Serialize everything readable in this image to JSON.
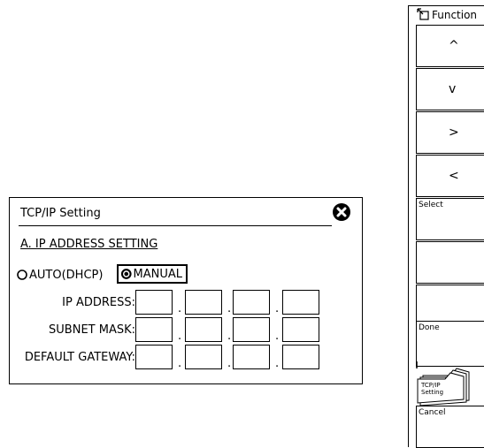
{
  "dialog": {
    "title": "TCP/IP Setting",
    "section": "A. IP ADDRESS SETTING",
    "radio_auto": "AUTO(DHCP)",
    "radio_manual": "MANUAL",
    "selected_mode": "MANUAL",
    "rows": [
      {
        "label": "IP ADDRESS:",
        "octets": [
          "",
          "",
          "",
          ""
        ]
      },
      {
        "label": "SUBNET MASK:",
        "octets": [
          "",
          "",
          "",
          ""
        ]
      },
      {
        "label": "DEFAULT GATEWAY:",
        "octets": [
          "",
          "",
          "",
          ""
        ]
      }
    ],
    "separator": "."
  },
  "panel": {
    "title": "Function",
    "icon": "function-corner-icon",
    "keys": [
      {
        "label": "",
        "symbol": "^"
      },
      {
        "label": "",
        "symbol": "v"
      },
      {
        "label": "",
        "symbol": ">"
      },
      {
        "label": "",
        "symbol": "<"
      },
      {
        "label": "Select",
        "symbol": ""
      },
      {
        "label": "",
        "symbol": ""
      },
      {
        "label": "",
        "symbol": ""
      },
      {
        "label": "Done",
        "symbol": ""
      }
    ],
    "stack_label": "TCP/IP Setting",
    "stack_label_line1": "TCP/IP",
    "stack_label_line2": "Setting",
    "cancel": "Cancel"
  }
}
